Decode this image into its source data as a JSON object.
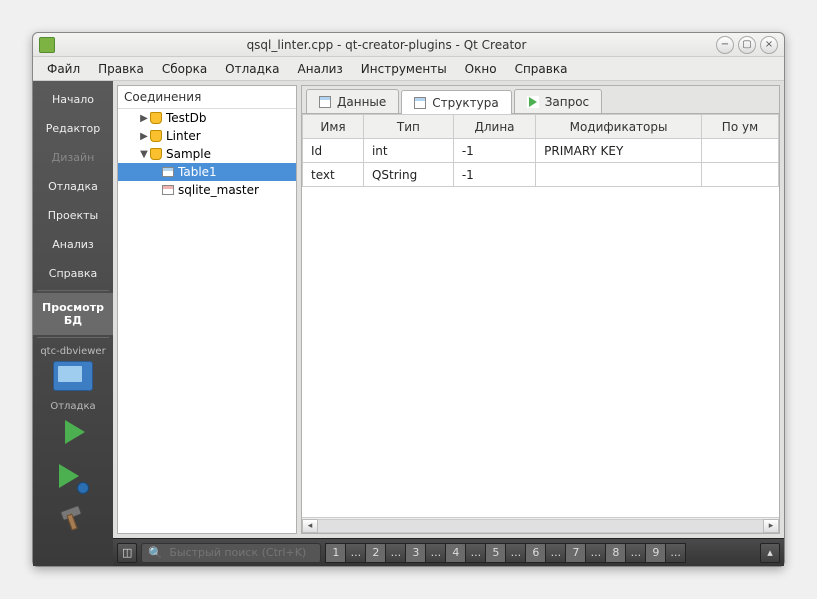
{
  "window": {
    "title": "qsql_linter.cpp - qt-creator-plugins - Qt Creator"
  },
  "menus": [
    "Файл",
    "Правка",
    "Сборка",
    "Отладка",
    "Анализ",
    "Инструменты",
    "Окно",
    "Справка"
  ],
  "leftbar": {
    "modes": [
      {
        "label": "Начало",
        "disabled": false
      },
      {
        "label": "Редактор",
        "disabled": false
      },
      {
        "label": "Дизайн",
        "disabled": true
      },
      {
        "label": "Отладка",
        "disabled": false
      },
      {
        "label": "Проекты",
        "disabled": false
      },
      {
        "label": "Анализ",
        "disabled": false
      },
      {
        "label": "Справка",
        "disabled": false
      },
      {
        "label": "Просмотр БД",
        "selected": true
      }
    ],
    "project": "qtc-dbviewer",
    "target": "Отладка"
  },
  "tree": {
    "header": "Соединения",
    "nodes": [
      {
        "label": "TestDb",
        "expanded": false,
        "depth": 1,
        "icon": "db"
      },
      {
        "label": "Linter",
        "expanded": false,
        "depth": 1,
        "icon": "db"
      },
      {
        "label": "Sample",
        "expanded": true,
        "depth": 1,
        "icon": "db"
      },
      {
        "label": "Table1",
        "depth": 2,
        "icon": "tbl",
        "selected": true
      },
      {
        "label": "sqlite_master",
        "depth": 2,
        "icon": "tbl-red"
      }
    ]
  },
  "tabs": [
    {
      "label": "Данные",
      "icon": "table"
    },
    {
      "label": "Структура",
      "icon": "table",
      "active": true
    },
    {
      "label": "Запрос",
      "icon": "play"
    }
  ],
  "grid": {
    "headers": [
      "Имя",
      "Тип",
      "Длина",
      "Модификаторы",
      "По ум"
    ],
    "rows": [
      [
        "Id",
        "int",
        "-1",
        "PRIMARY KEY",
        ""
      ],
      [
        "text",
        "QString",
        "-1",
        "",
        ""
      ]
    ]
  },
  "footer": {
    "search_placeholder": "Быстрый поиск (Ctrl+K)",
    "panes": [
      "1",
      "...",
      "2",
      "...",
      "3",
      "...",
      "4",
      "...",
      "5",
      "...",
      "6",
      "...",
      "7",
      "...",
      "8",
      "...",
      "9",
      "..."
    ]
  }
}
